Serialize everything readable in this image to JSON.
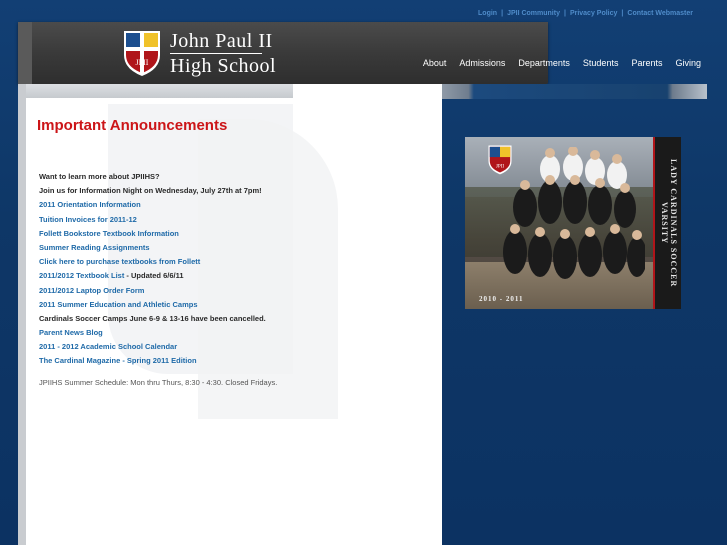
{
  "util_links": [
    "Login",
    "JPII Community",
    "Privacy Policy",
    "Contact Webmaster"
  ],
  "logo": {
    "line1": "John Paul II",
    "line2": "High School",
    "crest_text": "JPII"
  },
  "nav": [
    "About",
    "Admissions",
    "Departments",
    "Students",
    "Parents",
    "Giving"
  ],
  "announcements": {
    "title": "Important Announcements",
    "items": [
      {
        "text": "Want to learn more about JPIIHS?",
        "link": false
      },
      {
        "text": "Join us for Information Night on Wednesday, July 27th at 7pm!",
        "link": false
      },
      {
        "text": "2011 Orientation Information",
        "link": true
      },
      {
        "text": "Tuition Invoices for 2011-12",
        "link": true
      },
      {
        "text": "Follett Bookstore Textbook Information",
        "link": true
      },
      {
        "text": "Summer Reading Assignments",
        "link": true
      },
      {
        "text": "Click here to purchase textbooks from Follett",
        "link": true
      },
      {
        "text": "2011/2012 Textbook List",
        "link": true,
        "suffix": " - Updated 6/6/11"
      },
      {
        "text": "2011/2012 Laptop Order Form",
        "link": true
      },
      {
        "text": "2011 Summer Education and Athletic Camps",
        "link": true
      },
      {
        "text": "Cardinals Soccer Camps June 6-9 & 13-16 have been cancelled.",
        "link": false
      },
      {
        "text": "Parent News Blog",
        "link": true
      },
      {
        "text": "2011 - 2012 Academic School Calendar",
        "link": true
      },
      {
        "text": "The Cardinal Magazine - Spring 2011 Edition",
        "link": true
      }
    ],
    "schedule": "JPIIHS Summer Schedule: Mon thru Thurs, 8:30 - 4:30.  Closed Fridays."
  },
  "photo": {
    "side_text": "LADY CARDINALS SOCCER VARSITY",
    "year": "2010 - 2011",
    "crest_text": "JPII"
  },
  "colors": {
    "background": "#0f3a6d",
    "accent_red": "#cc1518",
    "link_blue": "#1f6aa8",
    "header_gray": "#3a3a3a"
  }
}
